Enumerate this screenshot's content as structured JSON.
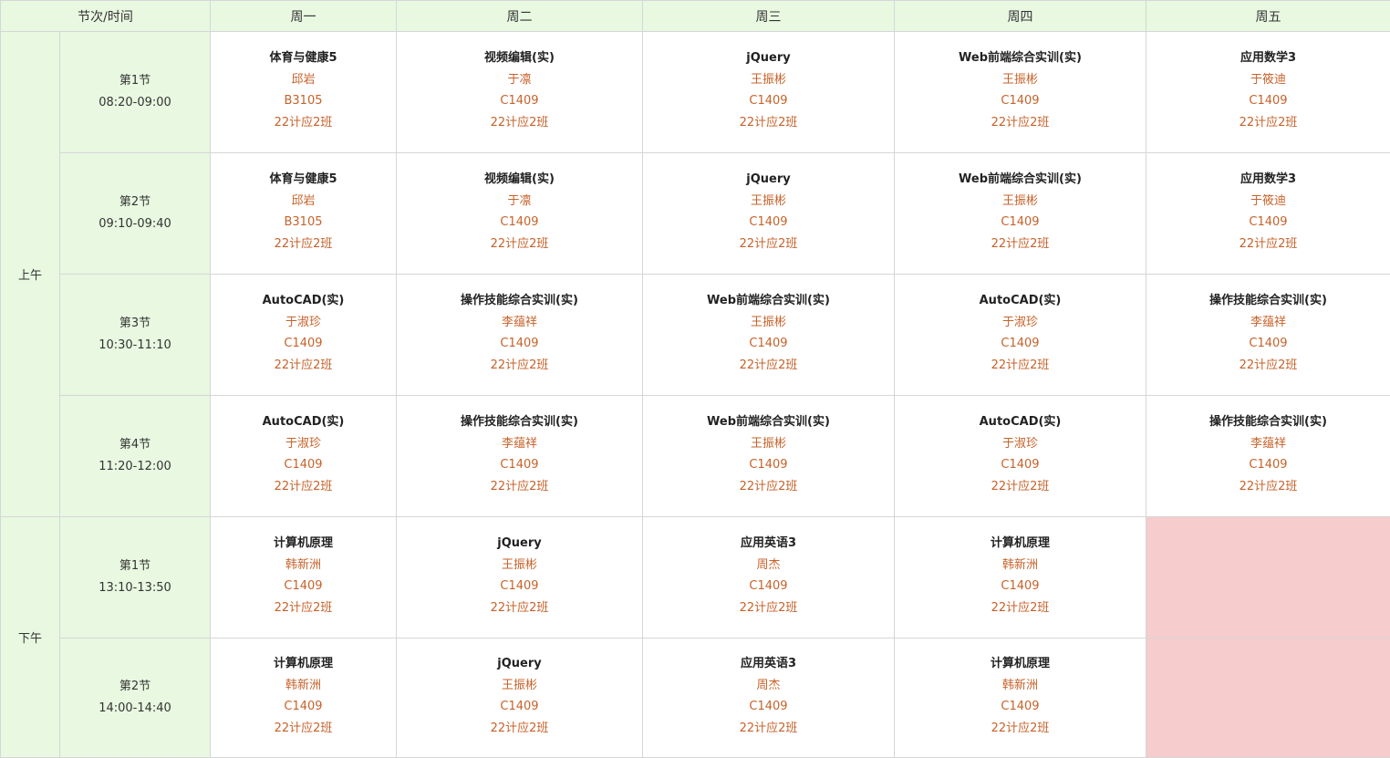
{
  "header": {
    "corner_label": "节次/时间",
    "days": [
      "周一",
      "周二",
      "周三",
      "周四",
      "周五"
    ]
  },
  "halves": [
    {
      "label": "上午",
      "row_count": 4
    },
    {
      "label": "下午",
      "row_count": 2
    }
  ],
  "rows": [
    {
      "period": "第1节",
      "time": "08:20-09:00",
      "cells": [
        {
          "course": "体育与健康5",
          "teacher": "邱岩",
          "room": "B3105",
          "class": "22计应2班"
        },
        {
          "course": "视频编辑(实)",
          "teacher": "于凛",
          "room": "C1409",
          "class": "22计应2班"
        },
        {
          "course": "jQuery",
          "teacher": "王振彬",
          "room": "C1409",
          "class": "22计应2班"
        },
        {
          "course": "Web前端综合实训(实)",
          "teacher": "王振彬",
          "room": "C1409",
          "class": "22计应2班"
        },
        {
          "course": "应用数学3",
          "teacher": "于筱迪",
          "room": "C1409",
          "class": "22计应2班"
        }
      ]
    },
    {
      "period": "第2节",
      "time": "09:10-09:40",
      "cells": [
        {
          "course": "体育与健康5",
          "teacher": "邱岩",
          "room": "B3105",
          "class": "22计应2班"
        },
        {
          "course": "视频编辑(实)",
          "teacher": "于凛",
          "room": "C1409",
          "class": "22计应2班"
        },
        {
          "course": "jQuery",
          "teacher": "王振彬",
          "room": "C1409",
          "class": "22计应2班"
        },
        {
          "course": "Web前端综合实训(实)",
          "teacher": "王振彬",
          "room": "C1409",
          "class": "22计应2班"
        },
        {
          "course": "应用数学3",
          "teacher": "于筱迪",
          "room": "C1409",
          "class": "22计应2班"
        }
      ]
    },
    {
      "period": "第3节",
      "time": "10:30-11:10",
      "cells": [
        {
          "course": "AutoCAD(实)",
          "teacher": "于淑珍",
          "room": "C1409",
          "class": "22计应2班"
        },
        {
          "course": "操作技能综合实训(实)",
          "teacher": "李蕴祥",
          "room": "C1409",
          "class": "22计应2班"
        },
        {
          "course": "Web前端综合实训(实)",
          "teacher": "王振彬",
          "room": "C1409",
          "class": "22计应2班"
        },
        {
          "course": "AutoCAD(实)",
          "teacher": "于淑珍",
          "room": "C1409",
          "class": "22计应2班"
        },
        {
          "course": "操作技能综合实训(实)",
          "teacher": "李蕴祥",
          "room": "C1409",
          "class": "22计应2班"
        }
      ]
    },
    {
      "period": "第4节",
      "time": "11:20-12:00",
      "cells": [
        {
          "course": "AutoCAD(实)",
          "teacher": "于淑珍",
          "room": "C1409",
          "class": "22计应2班"
        },
        {
          "course": "操作技能综合实训(实)",
          "teacher": "李蕴祥",
          "room": "C1409",
          "class": "22计应2班"
        },
        {
          "course": "Web前端综合实训(实)",
          "teacher": "王振彬",
          "room": "C1409",
          "class": "22计应2班"
        },
        {
          "course": "AutoCAD(实)",
          "teacher": "于淑珍",
          "room": "C1409",
          "class": "22计应2班"
        },
        {
          "course": "操作技能综合实训(实)",
          "teacher": "李蕴祥",
          "room": "C1409",
          "class": "22计应2班"
        }
      ]
    },
    {
      "period": "第1节",
      "time": "13:10-13:50",
      "cells": [
        {
          "course": "计算机原理",
          "teacher": "韩新洲",
          "room": "C1409",
          "class": "22计应2班"
        },
        {
          "course": "jQuery",
          "teacher": "王振彬",
          "room": "C1409",
          "class": "22计应2班"
        },
        {
          "course": "应用英语3",
          "teacher": "周杰",
          "room": "C1409",
          "class": "22计应2班"
        },
        {
          "course": "计算机原理",
          "teacher": "韩新洲",
          "room": "C1409",
          "class": "22计应2班"
        },
        null
      ]
    },
    {
      "period": "第2节",
      "time": "14:00-14:40",
      "cells": [
        {
          "course": "计算机原理",
          "teacher": "韩新洲",
          "room": "C1409",
          "class": "22计应2班"
        },
        {
          "course": "jQuery",
          "teacher": "王振彬",
          "room": "C1409",
          "class": "22计应2班"
        },
        {
          "course": "应用英语3",
          "teacher": "周杰",
          "room": "C1409",
          "class": "22计应2班"
        },
        {
          "course": "计算机原理",
          "teacher": "韩新洲",
          "room": "C1409",
          "class": "22计应2班"
        },
        null
      ]
    }
  ],
  "colors": {
    "header_bg": "#e8f8e1",
    "info_text": "#c6622a",
    "empty_cell_bg": "#f6cccc",
    "border": "#d6d6d6"
  }
}
